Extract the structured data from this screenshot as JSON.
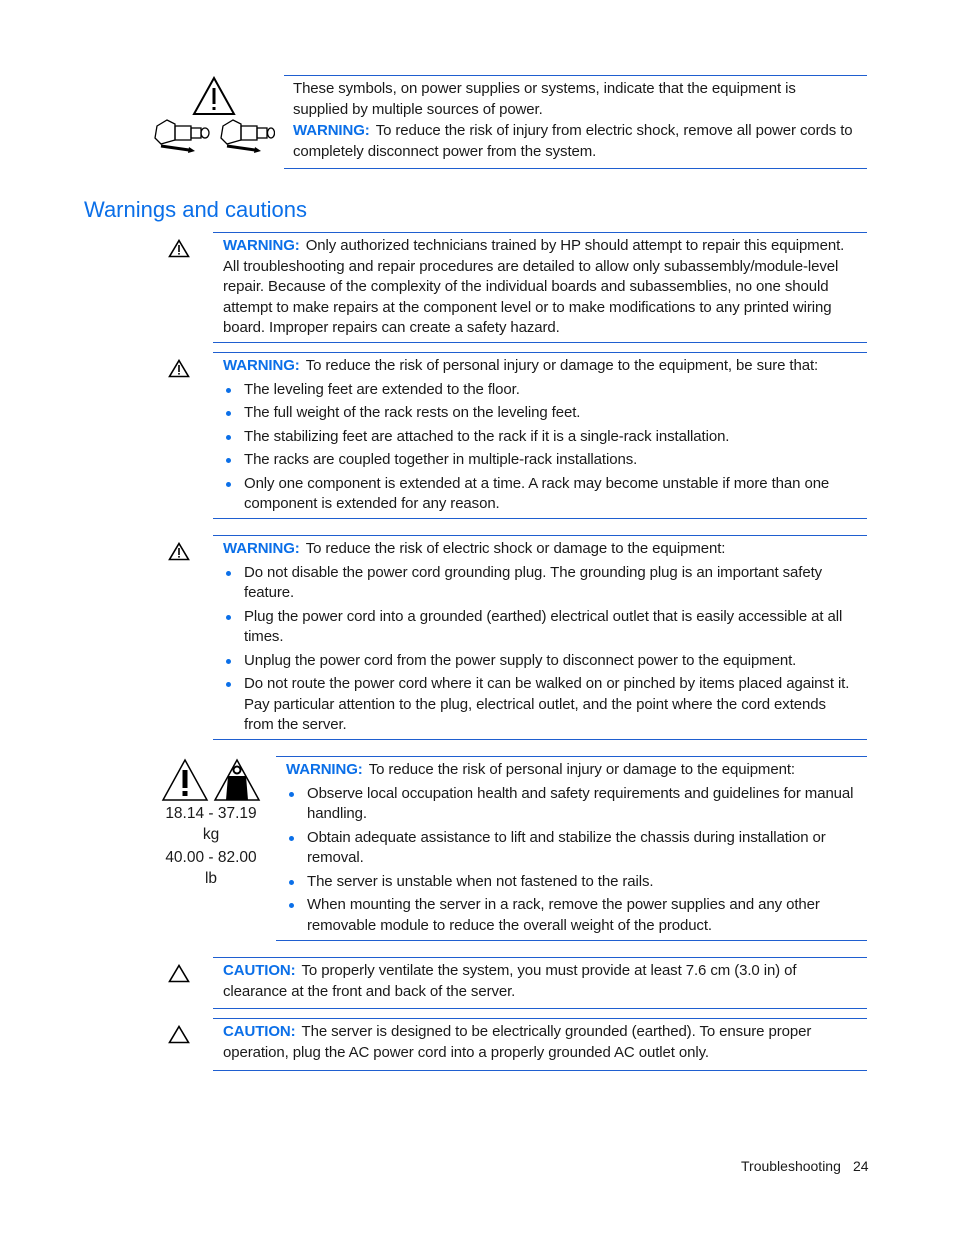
{
  "top_note": {
    "icon": "multiple-power-sources-icon",
    "text_line": "These symbols, on power supplies or systems, indicate that the equipment is supplied by multiple sources of power.",
    "warning_label": "WARNING:",
    "warning_text": "To reduce the risk of injury from electric shock, remove all power cords to completely disconnect power from the system."
  },
  "section_heading": "Warnings and cautions",
  "notices": [
    {
      "icon": "warning-triangle-icon",
      "label": "WARNING:",
      "text": "Only authorized technicians trained by HP should attempt to repair this equipment. All troubleshooting and repair procedures are detailed to allow only subassembly/module-level repair. Because of the complexity of the individual boards and subassemblies, no one should attempt to make repairs at the component level or to make modifications to any printed wiring board. Improper repairs can create a safety hazard."
    },
    {
      "icon": "warning-triangle-icon",
      "label": "WARNING:",
      "text": "To reduce the risk of personal injury or damage to the equipment, be sure that:",
      "bullets": [
        "The leveling feet are extended to the floor.",
        "The full weight of the rack rests on the leveling feet.",
        "The stabilizing feet are attached to the rack if it is a single-rack installation.",
        "The racks are coupled together in multiple-rack installations.",
        "Only one component is extended at a time. A rack may become unstable if more than one component is extended for any reason."
      ]
    },
    {
      "icon": "warning-triangle-icon",
      "label": "WARNING:",
      "text": "To reduce the risk of electric shock or damage to the equipment:",
      "bullets": [
        "Do not disable the power cord grounding plug. The grounding plug is an important safety feature.",
        "Plug the power cord into a grounded (earthed) electrical outlet that is easily accessible at all times.",
        "Unplug the power cord from the power supply to disconnect power to the equipment.",
        "Do not route the power cord where it can be walked on or pinched by items placed against it. Pay particular attention to the plug, electrical outlet, and the point where the cord extends from the server."
      ]
    },
    {
      "icon": "heavy-weight-warning-icon",
      "weight_kg": "18.14 - 37.19",
      "unit_kg": "kg",
      "weight_lb": "40.00 - 82.00",
      "unit_lb": "lb",
      "label": "WARNING:",
      "text": "To reduce the risk of personal injury or damage to the equipment:",
      "bullets": [
        "Observe local occupation health and safety requirements and guidelines for manual handling.",
        "Obtain adequate assistance to lift and stabilize the chassis during installation or removal.",
        "The server is unstable when not fastened to the rails.",
        "When mounting the server in a rack, remove the power supplies and any other removable module to reduce the overall weight of the product."
      ]
    },
    {
      "icon": "caution-triangle-icon",
      "label": "CAUTION:",
      "text": "To properly ventilate the system, you must provide at least 7.6 cm (3.0 in) of clearance at the front and back of the server."
    },
    {
      "icon": "caution-triangle-icon",
      "label": "CAUTION:",
      "text": "The server is designed to be electrically grounded (earthed). To ensure proper operation, plug the AC power cord into a properly grounded AC outlet only."
    }
  ],
  "footer": {
    "section": "Troubleshooting",
    "page_number": "24"
  },
  "colors": {
    "accent": "#0b6fe8",
    "rule": "#1f5fd0",
    "text": "#1a1a1a"
  }
}
